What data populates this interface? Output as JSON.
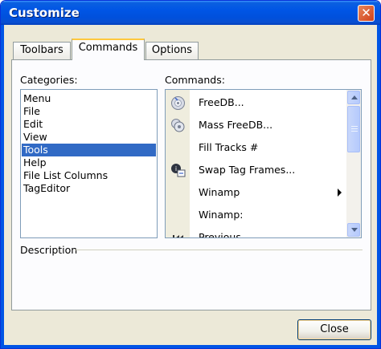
{
  "window": {
    "title": "Customize",
    "close_glyph": "✕"
  },
  "tabs": [
    {
      "label": "Toolbars",
      "selected": false
    },
    {
      "label": "Commands",
      "selected": true
    },
    {
      "label": "Options",
      "selected": false
    }
  ],
  "categories": {
    "label": "Categories:",
    "items": [
      "Menu",
      "File",
      "Edit",
      "View",
      "Tools",
      "Help",
      "File List Columns",
      "TagEditor"
    ],
    "selected": "Tools"
  },
  "commands": {
    "label": "Commands:",
    "items": [
      {
        "label": "FreeDB...",
        "icon": "freedb-icon"
      },
      {
        "label": "Mass FreeDB...",
        "icon": "mass-freedb-icon"
      },
      {
        "label": "Fill Tracks #",
        "icon": ""
      },
      {
        "label": "Swap Tag Frames...",
        "icon": "swap-tag-frames-icon"
      },
      {
        "label": "Winamp",
        "icon": "",
        "submenu": true
      },
      {
        "label": "Winamp:",
        "icon": ""
      },
      {
        "label": "Previous",
        "icon": "previous-icon"
      }
    ]
  },
  "description": {
    "label": "Description"
  },
  "buttons": {
    "close": "Close"
  }
}
